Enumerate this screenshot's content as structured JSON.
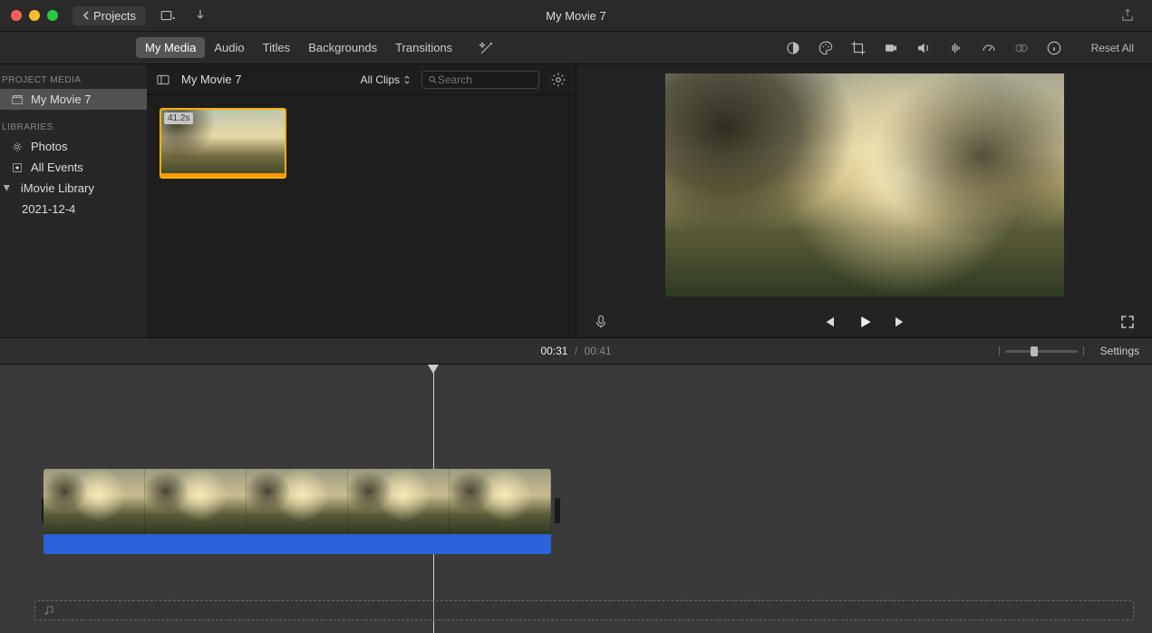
{
  "titlebar": {
    "projects_label": "Projects",
    "window_title": "My Movie 7"
  },
  "media_tabs": {
    "my_media": "My Media",
    "audio": "Audio",
    "titles": "Titles",
    "backgrounds": "Backgrounds",
    "transitions": "Transitions"
  },
  "adjust": {
    "reset_label": "Reset All"
  },
  "sidebar": {
    "project_media_hdr": "PROJECT MEDIA",
    "project_name": "My Movie 7",
    "libraries_hdr": "LIBRARIES",
    "photos": "Photos",
    "all_events": "All Events",
    "imovie_library": "iMovie Library",
    "event_date": "2021-12-4"
  },
  "browser": {
    "title": "My Movie 7",
    "filter_label": "All Clips",
    "search_placeholder": "Search",
    "clip_duration": "41.2s"
  },
  "timecode": {
    "current": "00:31",
    "separator": "/",
    "total": "00:41"
  },
  "timeline": {
    "settings_label": "Settings"
  }
}
